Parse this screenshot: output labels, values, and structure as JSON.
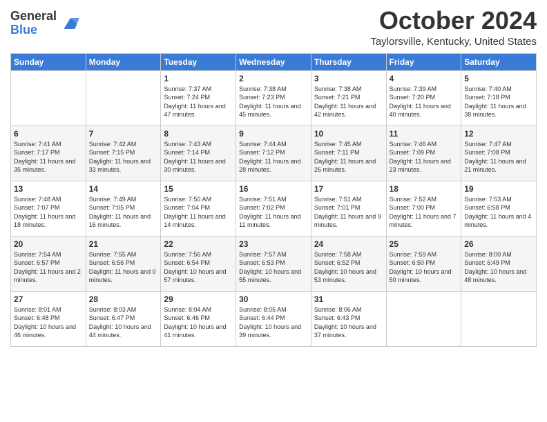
{
  "header": {
    "logo_general": "General",
    "logo_blue": "Blue",
    "month_title": "October 2024",
    "location": "Taylorsville, Kentucky, United States"
  },
  "weekdays": [
    "Sunday",
    "Monday",
    "Tuesday",
    "Wednesday",
    "Thursday",
    "Friday",
    "Saturday"
  ],
  "weeks": [
    [
      {
        "day": "",
        "sunrise": "",
        "sunset": "",
        "daylight": ""
      },
      {
        "day": "",
        "sunrise": "",
        "sunset": "",
        "daylight": ""
      },
      {
        "day": "1",
        "sunrise": "Sunrise: 7:37 AM",
        "sunset": "Sunset: 7:24 PM",
        "daylight": "Daylight: 11 hours and 47 minutes."
      },
      {
        "day": "2",
        "sunrise": "Sunrise: 7:38 AM",
        "sunset": "Sunset: 7:23 PM",
        "daylight": "Daylight: 11 hours and 45 minutes."
      },
      {
        "day": "3",
        "sunrise": "Sunrise: 7:38 AM",
        "sunset": "Sunset: 7:21 PM",
        "daylight": "Daylight: 11 hours and 42 minutes."
      },
      {
        "day": "4",
        "sunrise": "Sunrise: 7:39 AM",
        "sunset": "Sunset: 7:20 PM",
        "daylight": "Daylight: 11 hours and 40 minutes."
      },
      {
        "day": "5",
        "sunrise": "Sunrise: 7:40 AM",
        "sunset": "Sunset: 7:18 PM",
        "daylight": "Daylight: 11 hours and 38 minutes."
      }
    ],
    [
      {
        "day": "6",
        "sunrise": "Sunrise: 7:41 AM",
        "sunset": "Sunset: 7:17 PM",
        "daylight": "Daylight: 11 hours and 35 minutes."
      },
      {
        "day": "7",
        "sunrise": "Sunrise: 7:42 AM",
        "sunset": "Sunset: 7:15 PM",
        "daylight": "Daylight: 11 hours and 33 minutes."
      },
      {
        "day": "8",
        "sunrise": "Sunrise: 7:43 AM",
        "sunset": "Sunset: 7:14 PM",
        "daylight": "Daylight: 11 hours and 30 minutes."
      },
      {
        "day": "9",
        "sunrise": "Sunrise: 7:44 AM",
        "sunset": "Sunset: 7:12 PM",
        "daylight": "Daylight: 11 hours and 28 minutes."
      },
      {
        "day": "10",
        "sunrise": "Sunrise: 7:45 AM",
        "sunset": "Sunset: 7:11 PM",
        "daylight": "Daylight: 11 hours and 26 minutes."
      },
      {
        "day": "11",
        "sunrise": "Sunrise: 7:46 AM",
        "sunset": "Sunset: 7:09 PM",
        "daylight": "Daylight: 11 hours and 23 minutes."
      },
      {
        "day": "12",
        "sunrise": "Sunrise: 7:47 AM",
        "sunset": "Sunset: 7:08 PM",
        "daylight": "Daylight: 11 hours and 21 minutes."
      }
    ],
    [
      {
        "day": "13",
        "sunrise": "Sunrise: 7:48 AM",
        "sunset": "Sunset: 7:07 PM",
        "daylight": "Daylight: 11 hours and 18 minutes."
      },
      {
        "day": "14",
        "sunrise": "Sunrise: 7:49 AM",
        "sunset": "Sunset: 7:05 PM",
        "daylight": "Daylight: 11 hours and 16 minutes."
      },
      {
        "day": "15",
        "sunrise": "Sunrise: 7:50 AM",
        "sunset": "Sunset: 7:04 PM",
        "daylight": "Daylight: 11 hours and 14 minutes."
      },
      {
        "day": "16",
        "sunrise": "Sunrise: 7:51 AM",
        "sunset": "Sunset: 7:02 PM",
        "daylight": "Daylight: 11 hours and 11 minutes."
      },
      {
        "day": "17",
        "sunrise": "Sunrise: 7:51 AM",
        "sunset": "Sunset: 7:01 PM",
        "daylight": "Daylight: 11 hours and 9 minutes."
      },
      {
        "day": "18",
        "sunrise": "Sunrise: 7:52 AM",
        "sunset": "Sunset: 7:00 PM",
        "daylight": "Daylight: 11 hours and 7 minutes."
      },
      {
        "day": "19",
        "sunrise": "Sunrise: 7:53 AM",
        "sunset": "Sunset: 6:58 PM",
        "daylight": "Daylight: 11 hours and 4 minutes."
      }
    ],
    [
      {
        "day": "20",
        "sunrise": "Sunrise: 7:54 AM",
        "sunset": "Sunset: 6:57 PM",
        "daylight": "Daylight: 11 hours and 2 minutes."
      },
      {
        "day": "21",
        "sunrise": "Sunrise: 7:55 AM",
        "sunset": "Sunset: 6:56 PM",
        "daylight": "Daylight: 11 hours and 0 minutes."
      },
      {
        "day": "22",
        "sunrise": "Sunrise: 7:56 AM",
        "sunset": "Sunset: 6:54 PM",
        "daylight": "Daylight: 10 hours and 57 minutes."
      },
      {
        "day": "23",
        "sunrise": "Sunrise: 7:57 AM",
        "sunset": "Sunset: 6:53 PM",
        "daylight": "Daylight: 10 hours and 55 minutes."
      },
      {
        "day": "24",
        "sunrise": "Sunrise: 7:58 AM",
        "sunset": "Sunset: 6:52 PM",
        "daylight": "Daylight: 10 hours and 53 minutes."
      },
      {
        "day": "25",
        "sunrise": "Sunrise: 7:59 AM",
        "sunset": "Sunset: 6:50 PM",
        "daylight": "Daylight: 10 hours and 50 minutes."
      },
      {
        "day": "26",
        "sunrise": "Sunrise: 8:00 AM",
        "sunset": "Sunset: 6:49 PM",
        "daylight": "Daylight: 10 hours and 48 minutes."
      }
    ],
    [
      {
        "day": "27",
        "sunrise": "Sunrise: 8:01 AM",
        "sunset": "Sunset: 6:48 PM",
        "daylight": "Daylight: 10 hours and 46 minutes."
      },
      {
        "day": "28",
        "sunrise": "Sunrise: 8:03 AM",
        "sunset": "Sunset: 6:47 PM",
        "daylight": "Daylight: 10 hours and 44 minutes."
      },
      {
        "day": "29",
        "sunrise": "Sunrise: 8:04 AM",
        "sunset": "Sunset: 6:46 PM",
        "daylight": "Daylight: 10 hours and 41 minutes."
      },
      {
        "day": "30",
        "sunrise": "Sunrise: 8:05 AM",
        "sunset": "Sunset: 6:44 PM",
        "daylight": "Daylight: 10 hours and 39 minutes."
      },
      {
        "day": "31",
        "sunrise": "Sunrise: 8:06 AM",
        "sunset": "Sunset: 6:43 PM",
        "daylight": "Daylight: 10 hours and 37 minutes."
      },
      {
        "day": "",
        "sunrise": "",
        "sunset": "",
        "daylight": ""
      },
      {
        "day": "",
        "sunrise": "",
        "sunset": "",
        "daylight": ""
      }
    ]
  ]
}
